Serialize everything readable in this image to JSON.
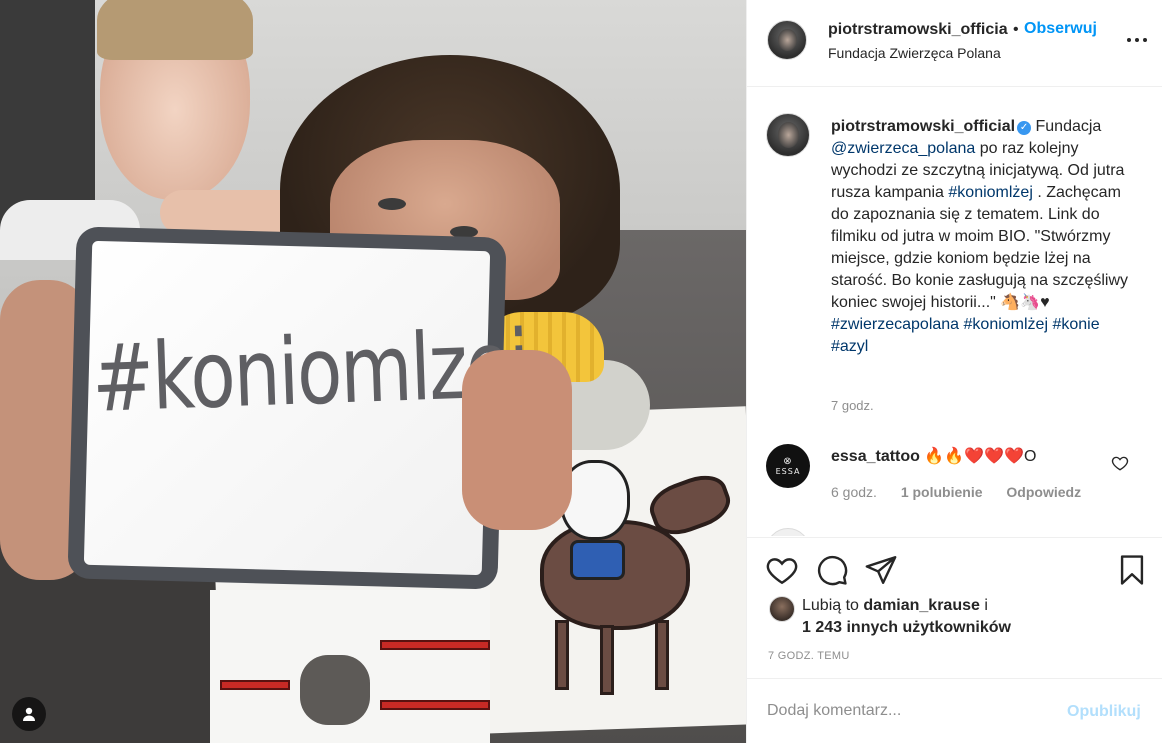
{
  "photo": {
    "board_text": "#koniomlzej"
  },
  "header": {
    "username": "piotrstramowski_official",
    "dot": "•",
    "follow_label": "Obserwuj",
    "location": "Fundacja Zwierzęca Polana"
  },
  "caption": {
    "username": "piotrstramowski_official",
    "verified_glyph": "✓",
    "part1": " Fundacja ",
    "mention": "@zwierzeca_polana",
    "part2": " po raz kolejny wychodzi ze szczytną inicjatywą. Od jutra rusza kampania ",
    "hashtag1": "#koniomlżej",
    "part3": " . Zachęcam do zapoznania się z tematem. Link do filmiku od jutra w moim BIO. \"Stwórzmy miejsce, gdzie koniom będzie lżej na starość. Bo konie zasługują na szczęśliwy koniec swojej historii...\" 🐴🦄♥",
    "tags": "#zwierzecapolana #koniomlżej #konie #azyl",
    "time": "7 godz."
  },
  "comment": {
    "avatar_text": "ESSA",
    "username": "essa_tattoo",
    "text": "🔥🔥❤️❤️❤️O",
    "time": "6 godz.",
    "likes": "1 polubienie",
    "reply": "Odpowiedz"
  },
  "likes": {
    "prefix": "Lubią to ",
    "user": "damian_krause",
    "suffix": " i",
    "others": "1 243 innych użytkowników"
  },
  "post_time": "7 GODZ. TEMU",
  "add_comment": {
    "placeholder": "Dodaj komentarz...",
    "publish_label": "Opublikuj"
  },
  "colors": {
    "accent": "#0095f6",
    "link": "#00376b",
    "muted": "#8e8e8e",
    "publish_disabled": "#b2dffc"
  }
}
